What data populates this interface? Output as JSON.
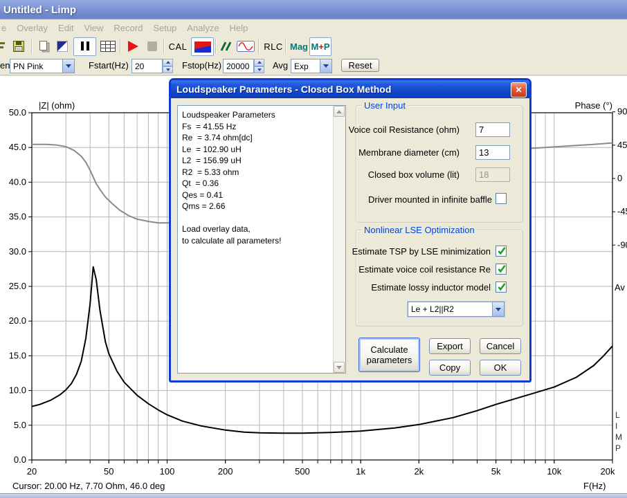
{
  "window": {
    "title": "Untitled - Limp"
  },
  "menu": {
    "items": [
      "e",
      "Overlay",
      "Edit",
      "View",
      "Record",
      "Setup",
      "Analyze",
      "Help"
    ]
  },
  "toolbar": {
    "cal_label": "CAL",
    "rlc_label": "RLC",
    "mag_label": "Mag",
    "mp_label": "M+P"
  },
  "controls": {
    "gen_label": "en",
    "gen_value": "PN Pink",
    "fstart_label": "Fstart(Hz)",
    "fstart_value": "20",
    "fstop_label": "Fstop(Hz)",
    "fstop_value": "20000",
    "avg_label": "Avg",
    "avg_value": "Exp",
    "reset_label": "Reset"
  },
  "chart_data": {
    "type": "line",
    "x_axis": {
      "scale": "log",
      "min": 20,
      "max": 20000,
      "unit": "F(Hz)",
      "tick_values": [
        20,
        50,
        100,
        200,
        500,
        1000,
        2000,
        5000,
        10000,
        20000
      ],
      "tick_labels": [
        "20",
        "50",
        "100",
        "200",
        "500",
        "1k",
        "2k",
        "5k",
        "10k",
        "20k"
      ]
    },
    "y_left": {
      "label": "|Z| (ohm)",
      "min": 0,
      "max": 50,
      "tick_step": 5,
      "tick_labels": [
        "0.0",
        "5.0",
        "10.0",
        "15.0",
        "20.0",
        "25.0",
        "30.0",
        "35.0",
        "40.0",
        "45.0",
        "50.0"
      ]
    },
    "y_right": {
      "label": "Phase (°)",
      "tick_values": [
        90,
        45,
        0,
        -45,
        -90
      ],
      "tick_labels": [
        "90",
        "45",
        "0",
        "-45",
        "-90"
      ]
    },
    "grid": true,
    "series": [
      {
        "name": "impedance",
        "axis": "left",
        "color": "#000000",
        "freq_hz": [
          20,
          22,
          25,
          28,
          30,
          32,
          34,
          36,
          38,
          40,
          41.5,
          43,
          45,
          48,
          50,
          55,
          60,
          70,
          80,
          90,
          100,
          120,
          150,
          200,
          250,
          300,
          400,
          500,
          700,
          1000,
          1500,
          2000,
          3000,
          4000,
          5000,
          7000,
          10000,
          13000,
          16000,
          18000,
          20000
        ],
        "ohm": [
          7.7,
          8.0,
          8.6,
          9.4,
          10.1,
          11.0,
          12.3,
          14.2,
          17.5,
          22.5,
          27.8,
          26.0,
          21.5,
          17.0,
          15.3,
          12.8,
          11.2,
          9.3,
          8.1,
          7.2,
          6.5,
          5.6,
          4.9,
          4.3,
          4.0,
          3.9,
          3.85,
          3.85,
          3.95,
          4.15,
          4.6,
          5.1,
          6.1,
          7.1,
          8.0,
          9.2,
          10.5,
          11.9,
          13.6,
          15.0,
          16.4
        ]
      },
      {
        "name": "phase",
        "axis": "right",
        "color": "#8a8a8a",
        "freq_hz": [
          20,
          24,
          27,
          30,
          33,
          36,
          38,
          40,
          41.5,
          43,
          45,
          48,
          52,
          57,
          63,
          70,
          80,
          90,
          100,
          120,
          150,
          200,
          300,
          500,
          800,
          1200,
          2000,
          3000,
          5000,
          8000,
          12000,
          16000,
          20000
        ],
        "deg": [
          46,
          46,
          45,
          43,
          38,
          30,
          22,
          11,
          2,
          -7,
          -15,
          -25,
          -34,
          -43,
          -50,
          -55,
          -58,
          -60,
          -60,
          -59,
          -54,
          -45,
          -28,
          -8,
          8,
          18,
          27,
          33,
          38,
          41,
          44,
          46,
          48
        ]
      }
    ],
    "watermark": "LIMP",
    "side_label": "Av"
  },
  "dialog": {
    "title": "Loudspeaker Parameters - Closed Box Method",
    "results_lines": [
      "Loudspeaker Parameters",
      "Fs  = 41.55 Hz",
      "Re  = 3.74 ohm[dc]",
      "Le  = 102.90 uH",
      "L2  = 156.99 uH",
      "R2  = 5.33 ohm",
      "Qt  = 0.36",
      "Qes = 0.41",
      "Qms = 2.66",
      "",
      "Load overlay data,",
      "to calculate all parameters!"
    ],
    "user_input": {
      "title": "User Input",
      "rows": [
        {
          "label": "Voice coil Resistance (ohm)",
          "value": "7",
          "type": "input"
        },
        {
          "label": "Membrane diameter (cm)",
          "value": "13",
          "type": "input"
        },
        {
          "label": "Closed box volume (lit)",
          "value": "18",
          "type": "input-disabled"
        },
        {
          "label": "Driver mounted in infinite baffle",
          "type": "checkbox",
          "checked": false
        }
      ]
    },
    "lse": {
      "title": "Nonlinear LSE Optimization",
      "rows": [
        {
          "label": "Estimate TSP by LSE minimization",
          "checked": true
        },
        {
          "label": "Estimate voice coil resistance Re",
          "checked": true
        },
        {
          "label": "Estimate lossy inductor model",
          "checked": true
        }
      ],
      "model_value": "Le + L2||R2"
    },
    "buttons": [
      {
        "id": "calculate",
        "label": "Calculate parameters"
      },
      {
        "id": "export",
        "label": "Export"
      },
      {
        "id": "cancel",
        "label": "Cancel"
      },
      {
        "id": "copy",
        "label": "Copy"
      },
      {
        "id": "ok",
        "label": "OK"
      }
    ]
  },
  "status": {
    "cursor": "Cursor: 20.00 Hz, 7.70 Ohm, 46.0 deg",
    "xunit": "F(Hz)"
  }
}
